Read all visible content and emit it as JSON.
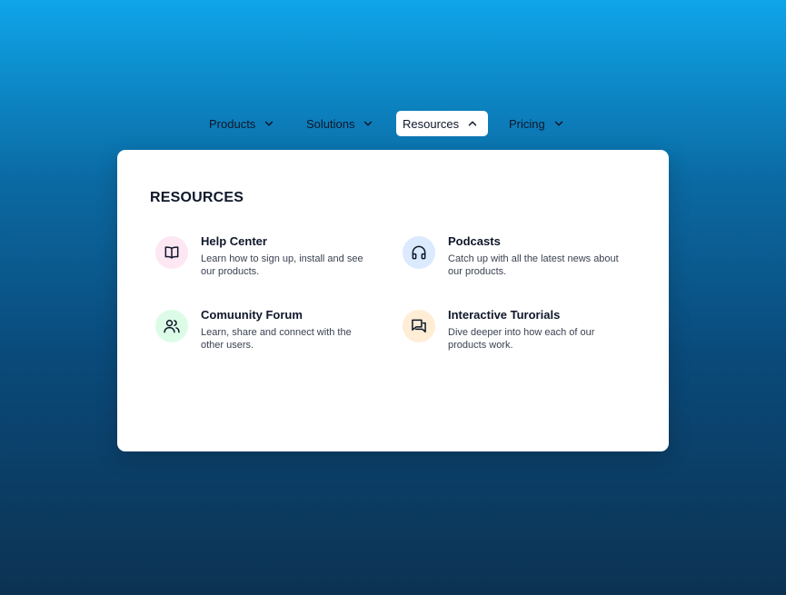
{
  "nav": {
    "items": [
      {
        "label": "Products",
        "icon": "chevron-down-icon",
        "active": false
      },
      {
        "label": "Solutions",
        "icon": "chevron-down-icon",
        "active": false
      },
      {
        "label": "Resources",
        "icon": "chevron-up-icon",
        "active": true
      },
      {
        "label": "Pricing",
        "icon": "chevron-down-icon",
        "active": false
      }
    ]
  },
  "panel": {
    "title": "RESOURCES",
    "items": [
      {
        "title": "Help Center",
        "description": "Learn how to sign up, install and see our products.",
        "icon": "book-icon",
        "icon_bg": "#fce7f3"
      },
      {
        "title": "Podcasts",
        "description": "Catch up with all the latest news about our products.",
        "icon": "headphones-icon",
        "icon_bg": "#dbeafe"
      },
      {
        "title": "Comuunity Forum",
        "description": "Learn, share and connect with the other users.",
        "icon": "users-icon",
        "icon_bg": "#dcfce7"
      },
      {
        "title": "Interactive Turorials",
        "description": "Dive deeper into how each of our products work.",
        "icon": "chat-icon",
        "icon_bg": "#ffedd5"
      }
    ]
  },
  "colors": {
    "background_top": "#0ea5e9",
    "background_bottom": "#0c3252",
    "panel": "#ffffff",
    "text": "#0f172a"
  }
}
